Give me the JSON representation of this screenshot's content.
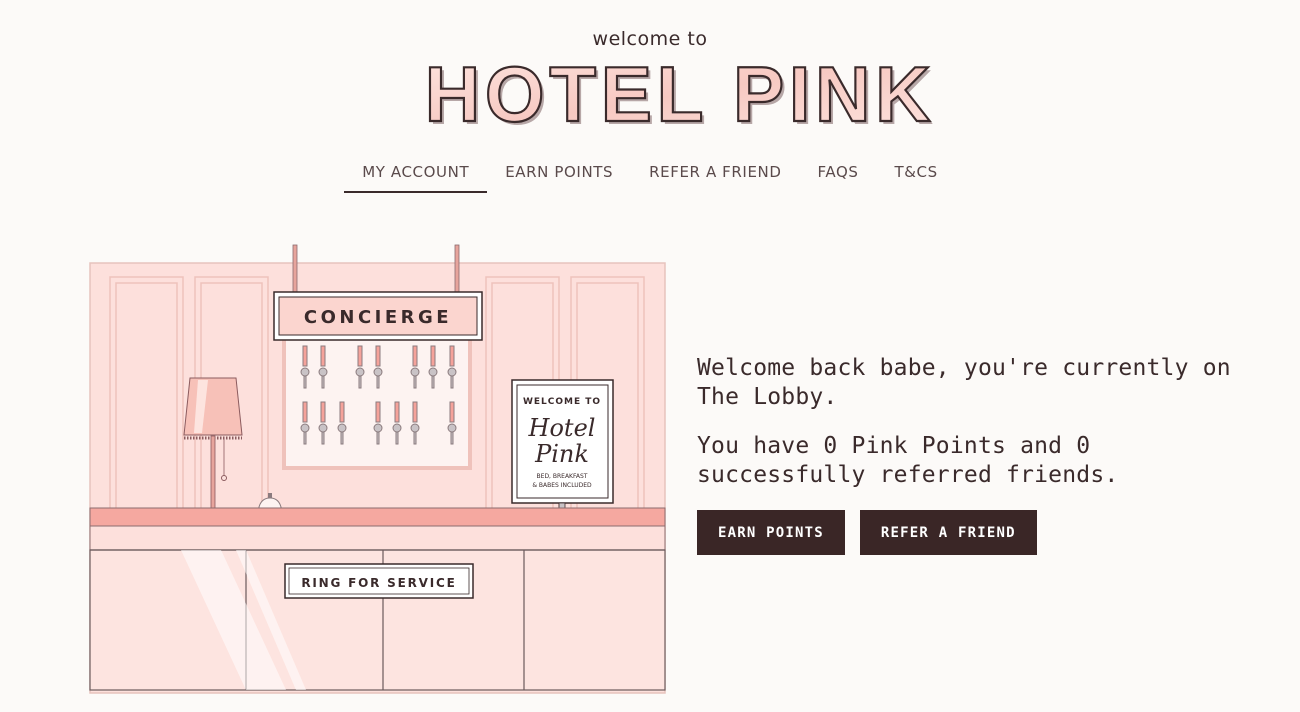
{
  "header": {
    "welcome_text": "welcome to",
    "logo_text": "HOTEL PINK"
  },
  "nav": {
    "items": [
      {
        "label": "MY ACCOUNT",
        "active": true
      },
      {
        "label": "EARN POINTS"
      },
      {
        "label": "REFER A FRIEND"
      },
      {
        "label": "FAQS"
      },
      {
        "label": "T&CS"
      }
    ]
  },
  "illustration": {
    "concierge_sign": "CONCIERGE",
    "service_sign": "RING FOR SERVICE",
    "easel": {
      "line1": "WELCOME TO",
      "line2": "Hotel",
      "line3": "Pink",
      "line4": "BED, BREAKFAST",
      "line5": "& BABES INCLUDED"
    }
  },
  "main": {
    "welcome_message": "Welcome back babe, you're currently on The Lobby.",
    "points_message": "You have 0 Pink Points and 0 successfully referred friends.",
    "earn_button": "EARN POINTS",
    "refer_button": "REFER A FRIEND"
  },
  "colors": {
    "background": "#fcfaf8",
    "wall_pink": "#fde0dc",
    "accent_pink": "#f3a9a1",
    "dark": "#3a2626"
  }
}
